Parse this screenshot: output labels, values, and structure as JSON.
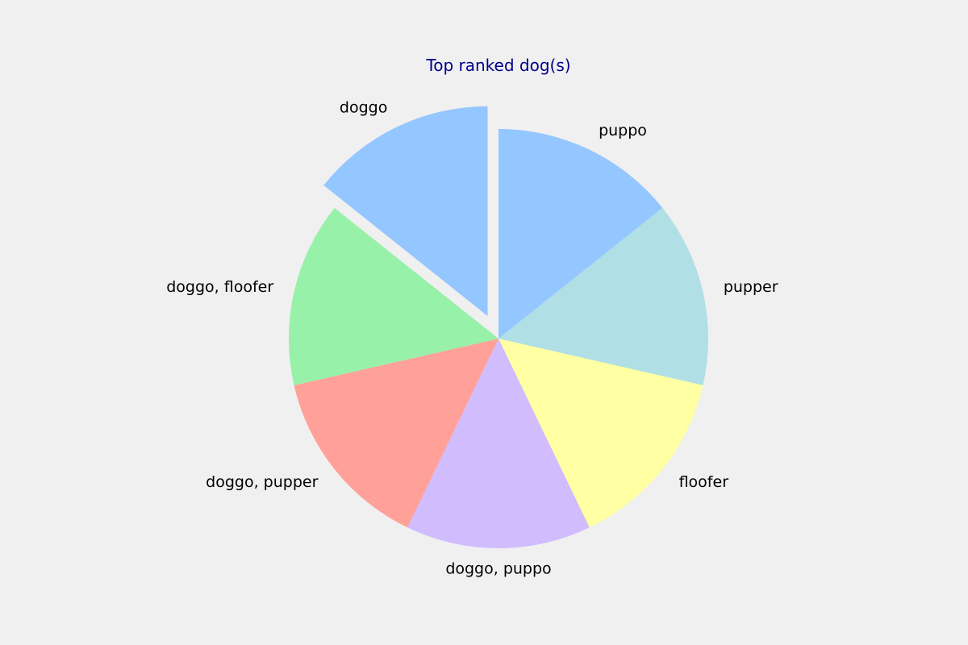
{
  "chart_data": {
    "type": "pie",
    "title": "Top ranked dog(s)",
    "title_color": "#00008b",
    "start": "top",
    "direction": "clockwise",
    "slices": [
      {
        "label": "puppo",
        "value": 1,
        "color": "#94c6ff",
        "exploded": false
      },
      {
        "label": "pupper",
        "value": 1,
        "color": "#b0dfe5",
        "exploded": false
      },
      {
        "label": "floofer",
        "value": 1,
        "color": "#ffffa3",
        "exploded": false
      },
      {
        "label": "doggo, puppo",
        "value": 1,
        "color": "#d1bcfe",
        "exploded": false
      },
      {
        "label": "doggo, pupper",
        "value": 1,
        "color": "#ffa199",
        "exploded": false
      },
      {
        "label": "doggo, floofer",
        "value": 1,
        "color": "#98f1a9",
        "exploded": false
      },
      {
        "label": "doggo",
        "value": 1,
        "color": "#94c6ff",
        "exploded": true
      }
    ]
  }
}
